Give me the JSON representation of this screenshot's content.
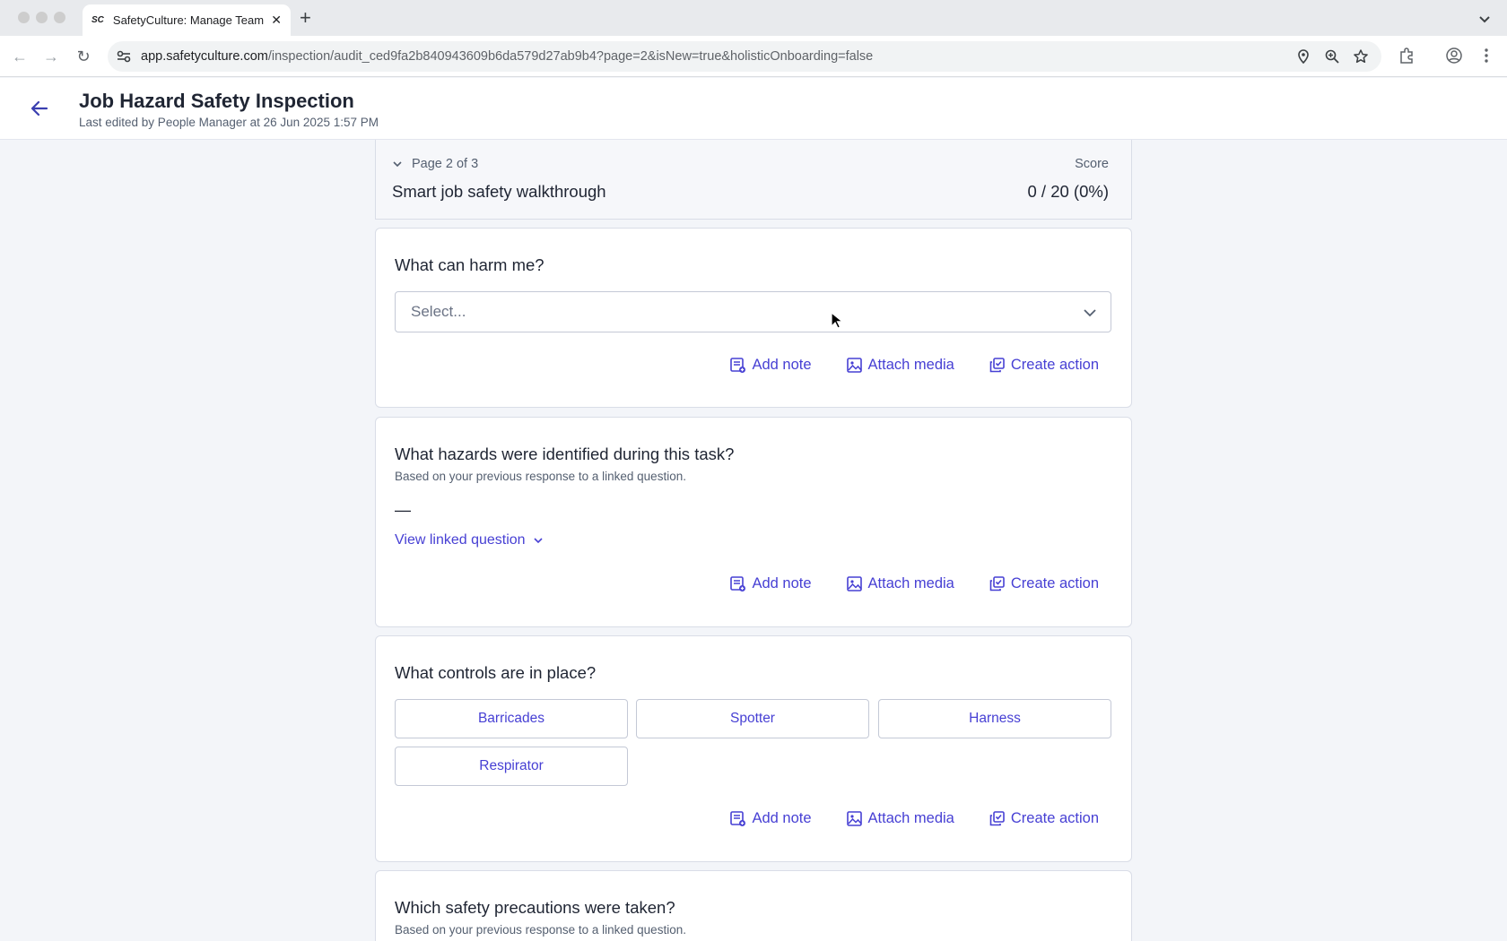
{
  "browser": {
    "tab_title": "SafetyCulture: Manage Teams",
    "tab_favicon": "SC",
    "url_host": "app.safetyculture.com",
    "url_path": "/inspection/audit_ced9fa2b840943609b6da579d27ab9b4?page=2&isNew=true&holisticOnboarding=false"
  },
  "header": {
    "title": "Job Hazard Safety Inspection",
    "subtitle": "Last edited by People Manager at 26 Jun 2025 1:57 PM"
  },
  "page": {
    "indicator": "Page 2 of 3",
    "title": "Smart job safety walkthrough",
    "score_label": "Score",
    "score_value": "0 / 20 (0%)"
  },
  "actions": {
    "add_note": "Add note",
    "attach_media": "Attach media",
    "create_action": "Create action"
  },
  "questions": [
    {
      "text": "What can harm me?",
      "placeholder": "Select..."
    },
    {
      "text": "What hazards were identified during this task?",
      "sub": "Based on your previous response to a linked question.",
      "answer": "—",
      "link": "View linked question"
    },
    {
      "text": "What controls are in place?",
      "options": [
        "Barricades",
        "Spotter",
        "Harness",
        "Respirator"
      ]
    },
    {
      "text": "Which safety precautions were taken?",
      "sub": "Based on your previous response to a linked question."
    }
  ],
  "colors": {
    "accent": "#4740d4",
    "text": "#1f2533",
    "muted": "#545f70"
  }
}
